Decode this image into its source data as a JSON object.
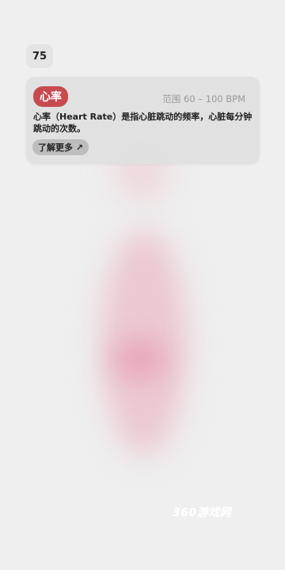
{
  "metric_value": "75",
  "info_card": {
    "title": "心率",
    "range": "范围 60 – 100 BPM",
    "description": "心率（Heart Rate）是指心脏跳动的频率，心脏每分钟跳动的次数。",
    "learn_more": "了解更多 ↗"
  },
  "watermark": "360游戏网",
  "colors": {
    "background": "#efefef",
    "chip": "#c74a4f",
    "card": "#e0e0e0"
  }
}
